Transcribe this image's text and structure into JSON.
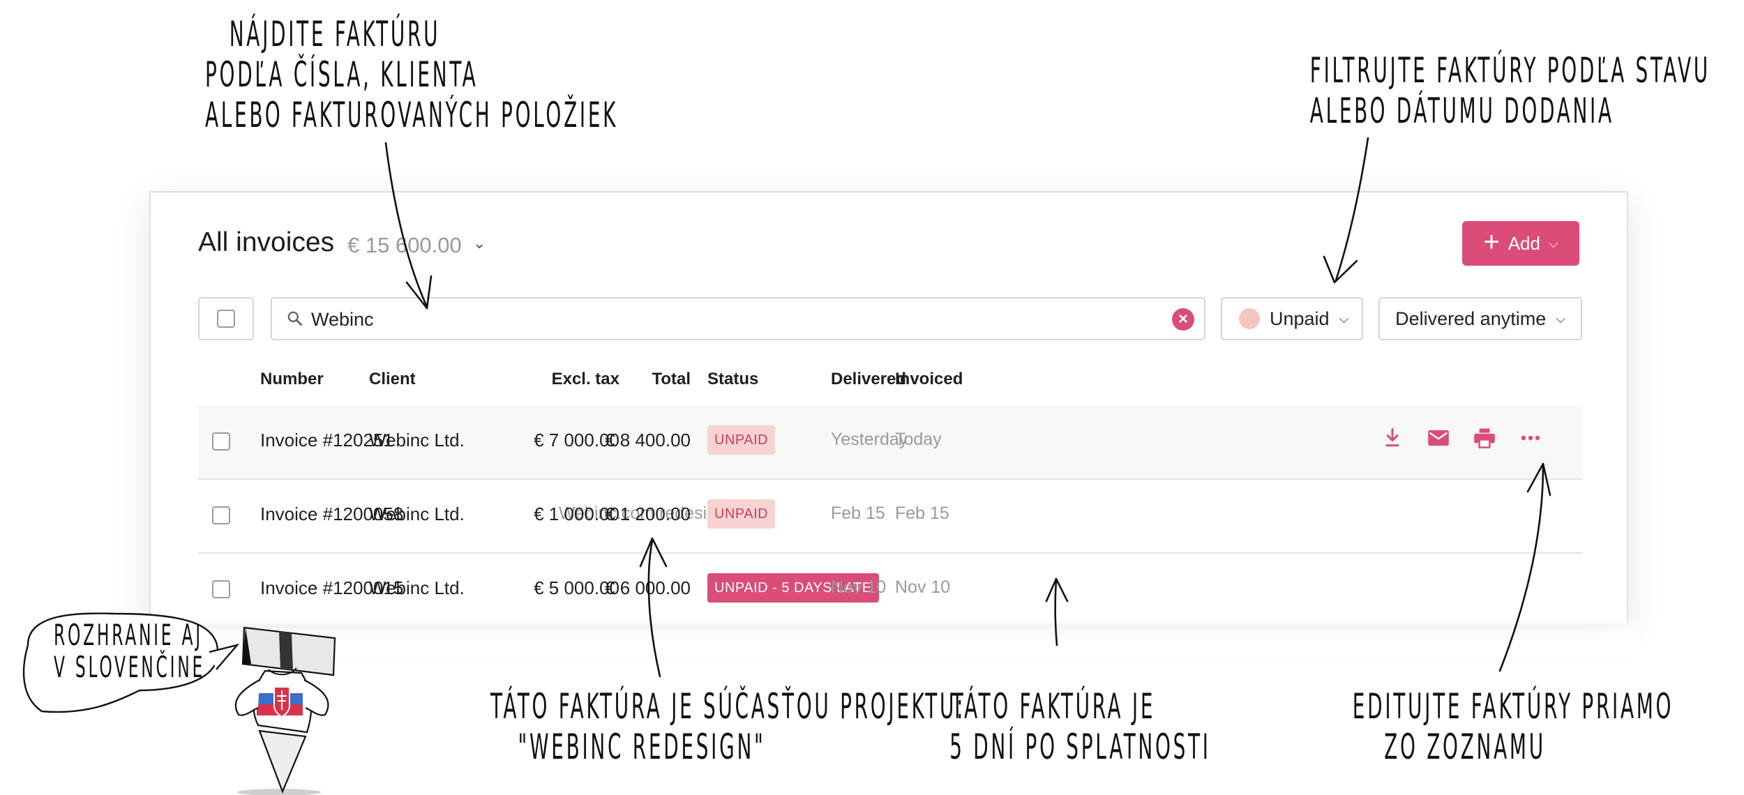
{
  "annotations": {
    "search_note": [
      "Nájdite faktúru",
      "podľa čísla, klienta",
      "alebo fakturovaných položiek"
    ],
    "filter_note": [
      "Filtrujte faktúry podľa stavu",
      "alebo dátumu dodania"
    ],
    "project_note": [
      "Táto faktúra je súčasťou projektu:",
      "\"Webinc redesign\""
    ],
    "late_note": [
      "Táto faktúra je",
      "5 dní po splatnosti"
    ],
    "edit_note": [
      "Editujte faktúry priamo",
      "zo zoznamu"
    ],
    "mascot_bubble": [
      "Rozhranie aj",
      "v slovenčine"
    ]
  },
  "header": {
    "title": "All invoices",
    "total": "€ 15 600.00",
    "add_label": "Add"
  },
  "search": {
    "value": "Webinc"
  },
  "filters": {
    "status": "Unpaid",
    "delivered": "Delivered anytime"
  },
  "table": {
    "columns": [
      "Number",
      "Client",
      "Excl. tax",
      "Total",
      "Status",
      "Delivered",
      "Invoiced"
    ],
    "rows": [
      {
        "number": "Invoice #120251",
        "client": "Webinc Ltd.",
        "project": "",
        "excl_tax": "€ 7 000.00",
        "total": "€ 8 400.00",
        "status": "UNPAID",
        "delivered": "Yesterday",
        "invoiced": "Today"
      },
      {
        "number": "Invoice #1200058",
        "client": "Webinc Ltd.",
        "project": "Webinc.com redesign",
        "excl_tax": "€ 1 000.00",
        "total": "€ 1 200.00",
        "status": "UNPAID",
        "delivered": "Feb 15",
        "invoiced": "Feb 15"
      },
      {
        "number": "Invoice #1200015",
        "client": "Webinc Ltd.",
        "project": "",
        "excl_tax": "€ 5 000.00",
        "total": "€ 6 000.00",
        "status": "UNPAID - 5 DAYS LATE",
        "delivered": "Nov 10",
        "invoiced": "Nov 10"
      }
    ]
  },
  "row_actions": [
    "download-icon",
    "mail-icon",
    "print-icon",
    "more-icon"
  ],
  "colors": {
    "accent": "#d94d78",
    "unpaid_badge_bg": "#f7d3cf",
    "muted_text": "#9a9a9a"
  }
}
